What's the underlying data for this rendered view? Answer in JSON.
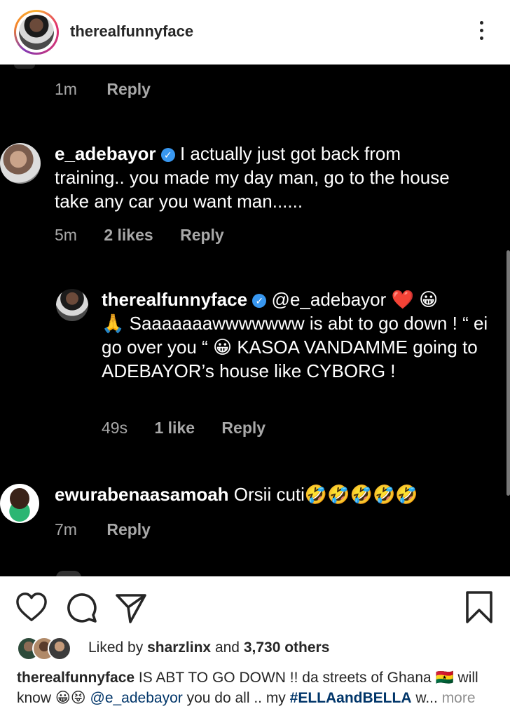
{
  "header": {
    "username": "therealfunnyface"
  },
  "comments": [
    {
      "meta_time": "1m",
      "reply_label": "Reply"
    },
    {
      "username": "e_adebayor",
      "text": " I actually just got back from training.. you made my day man, go to the house take any car you want man......",
      "time": "5m",
      "likes": "2 likes",
      "reply_label": "Reply"
    },
    {
      "username": "therealfunnyface",
      "mention": "@e_adebayor",
      "emojis_1": "❤️ 😀",
      "emoji_pray": "🙏",
      "text_1": " Saaaaaaawwwwwww is abt to go down ! “ ei go over you “ ",
      "emoji_grin": "😀",
      "text_2": " KASOA VANDAMME going to ADEBAYOR’s house like CYBORG !",
      "time": "49s",
      "likes": "1 like",
      "reply_label": "Reply"
    },
    {
      "username": "ewurabenaasamoah",
      "text": " Orsii cuti",
      "emojis": "🤣🤣🤣🤣🤣",
      "time": "7m",
      "reply_label": "Reply"
    }
  ],
  "icons": {
    "like": "heart-icon",
    "comment": "comment-icon",
    "share": "send-icon",
    "save": "bookmark-icon",
    "more": "more-vertical-icon"
  },
  "likes": {
    "prefix": "Liked by ",
    "user": "sharzlinx",
    "and": " and ",
    "count": "3,730 others"
  },
  "caption": {
    "username": "therealfunnyface",
    "text_1": " IS ABT TO GO DOWN !! da streets of Ghana ",
    "flag": "🇬🇭",
    "text_2": " will know ",
    "emojis": "😀😝",
    "mention": "@e_adebayor",
    "text_3": "  you do all .. my ",
    "hashtag": "#ELLAandBELLA",
    "text_4": " w...",
    "more_label": " more"
  },
  "colors": {
    "accent_blue": "#3897f0",
    "dark_bg": "#000000",
    "meta_gray": "#a8a8a8",
    "link_blue": "#003569"
  }
}
